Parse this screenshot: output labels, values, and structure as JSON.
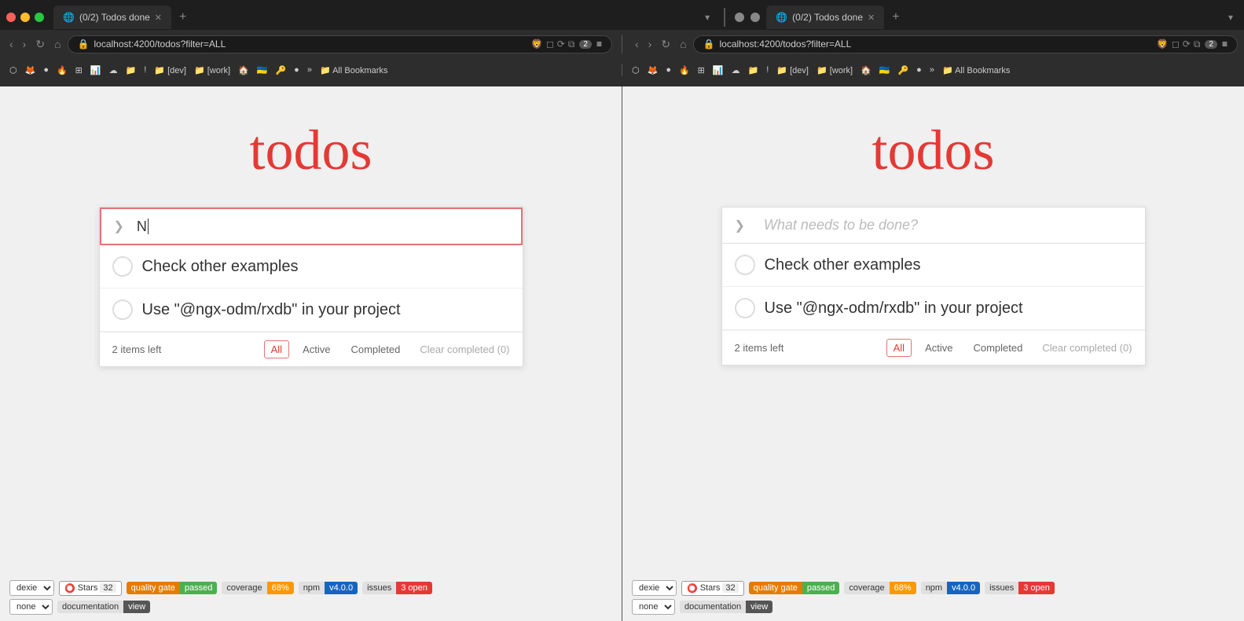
{
  "browser": {
    "left": {
      "traffic_lights": [
        "red",
        "yellow",
        "green"
      ],
      "tab_label": "(0/2) Todos done",
      "url": "localhost:4200/todos?filter=ALL",
      "tab_new_label": "+",
      "chevron_label": "▾"
    },
    "right": {
      "tab_label": "(0/2) Todos done",
      "url": "localhost:4200/todos?filter=ALL"
    }
  },
  "panels": [
    {
      "id": "left",
      "title": "todos",
      "input_value": "N",
      "input_placeholder": "What needs to be done?",
      "toggle_label": "❯",
      "items": [
        {
          "text": "Check other examples",
          "done": false
        },
        {
          "text": "Use \"@ngx-odm/rxdb\" in your project",
          "done": false
        }
      ],
      "footer": {
        "count": "2 items left",
        "filters": [
          {
            "label": "All",
            "active": true
          },
          {
            "label": "Active",
            "active": false
          },
          {
            "label": "Completed",
            "active": false
          }
        ],
        "clear_label": "Clear completed (0)"
      },
      "badges": {
        "stars_label": "Stars",
        "stars_count": "32",
        "quality_gate_label": "quality gate",
        "quality_gate_value": "passed",
        "coverage_label": "coverage",
        "coverage_value": "68%",
        "npm_label": "npm",
        "npm_value": "v4.0.0",
        "issues_label": "issues",
        "issues_value": "3 open",
        "doc_label": "documentation",
        "doc_value": "view"
      },
      "select1_options": [
        "dexie"
      ],
      "select2_options": [
        "none"
      ]
    },
    {
      "id": "right",
      "title": "todos",
      "input_value": "",
      "input_placeholder": "What needs to be done?",
      "toggle_label": "❯",
      "items": [
        {
          "text": "Check other examples",
          "done": false
        },
        {
          "text": "Use \"@ngx-odm/rxdb\" in your project",
          "done": false
        }
      ],
      "footer": {
        "count": "2 items left",
        "filters": [
          {
            "label": "All",
            "active": true
          },
          {
            "label": "Active",
            "active": false
          },
          {
            "label": "Completed",
            "active": false
          }
        ],
        "clear_label": "Clear completed (0)"
      },
      "badges": {
        "stars_label": "Stars",
        "stars_count": "32",
        "quality_gate_label": "quality gate",
        "quality_gate_value": "passed",
        "coverage_label": "coverage",
        "coverage_value": "68%",
        "npm_label": "npm",
        "npm_value": "v4.0.0",
        "issues_label": "issues",
        "issues_value": "3 open",
        "doc_label": "documentation",
        "doc_value": "view"
      },
      "select1_options": [
        "dexie"
      ],
      "select2_options": [
        "none"
      ]
    }
  ],
  "bookmarks": [
    "⬡",
    "🦊",
    "🟣",
    "🔥",
    "📊",
    "☁",
    "📁",
    "!",
    "📁",
    "[dev]",
    "📁",
    "[work]",
    "🏠",
    "🇺🇦",
    "🔑",
    "●"
  ],
  "all_bookmarks_label": "All Bookmarks"
}
